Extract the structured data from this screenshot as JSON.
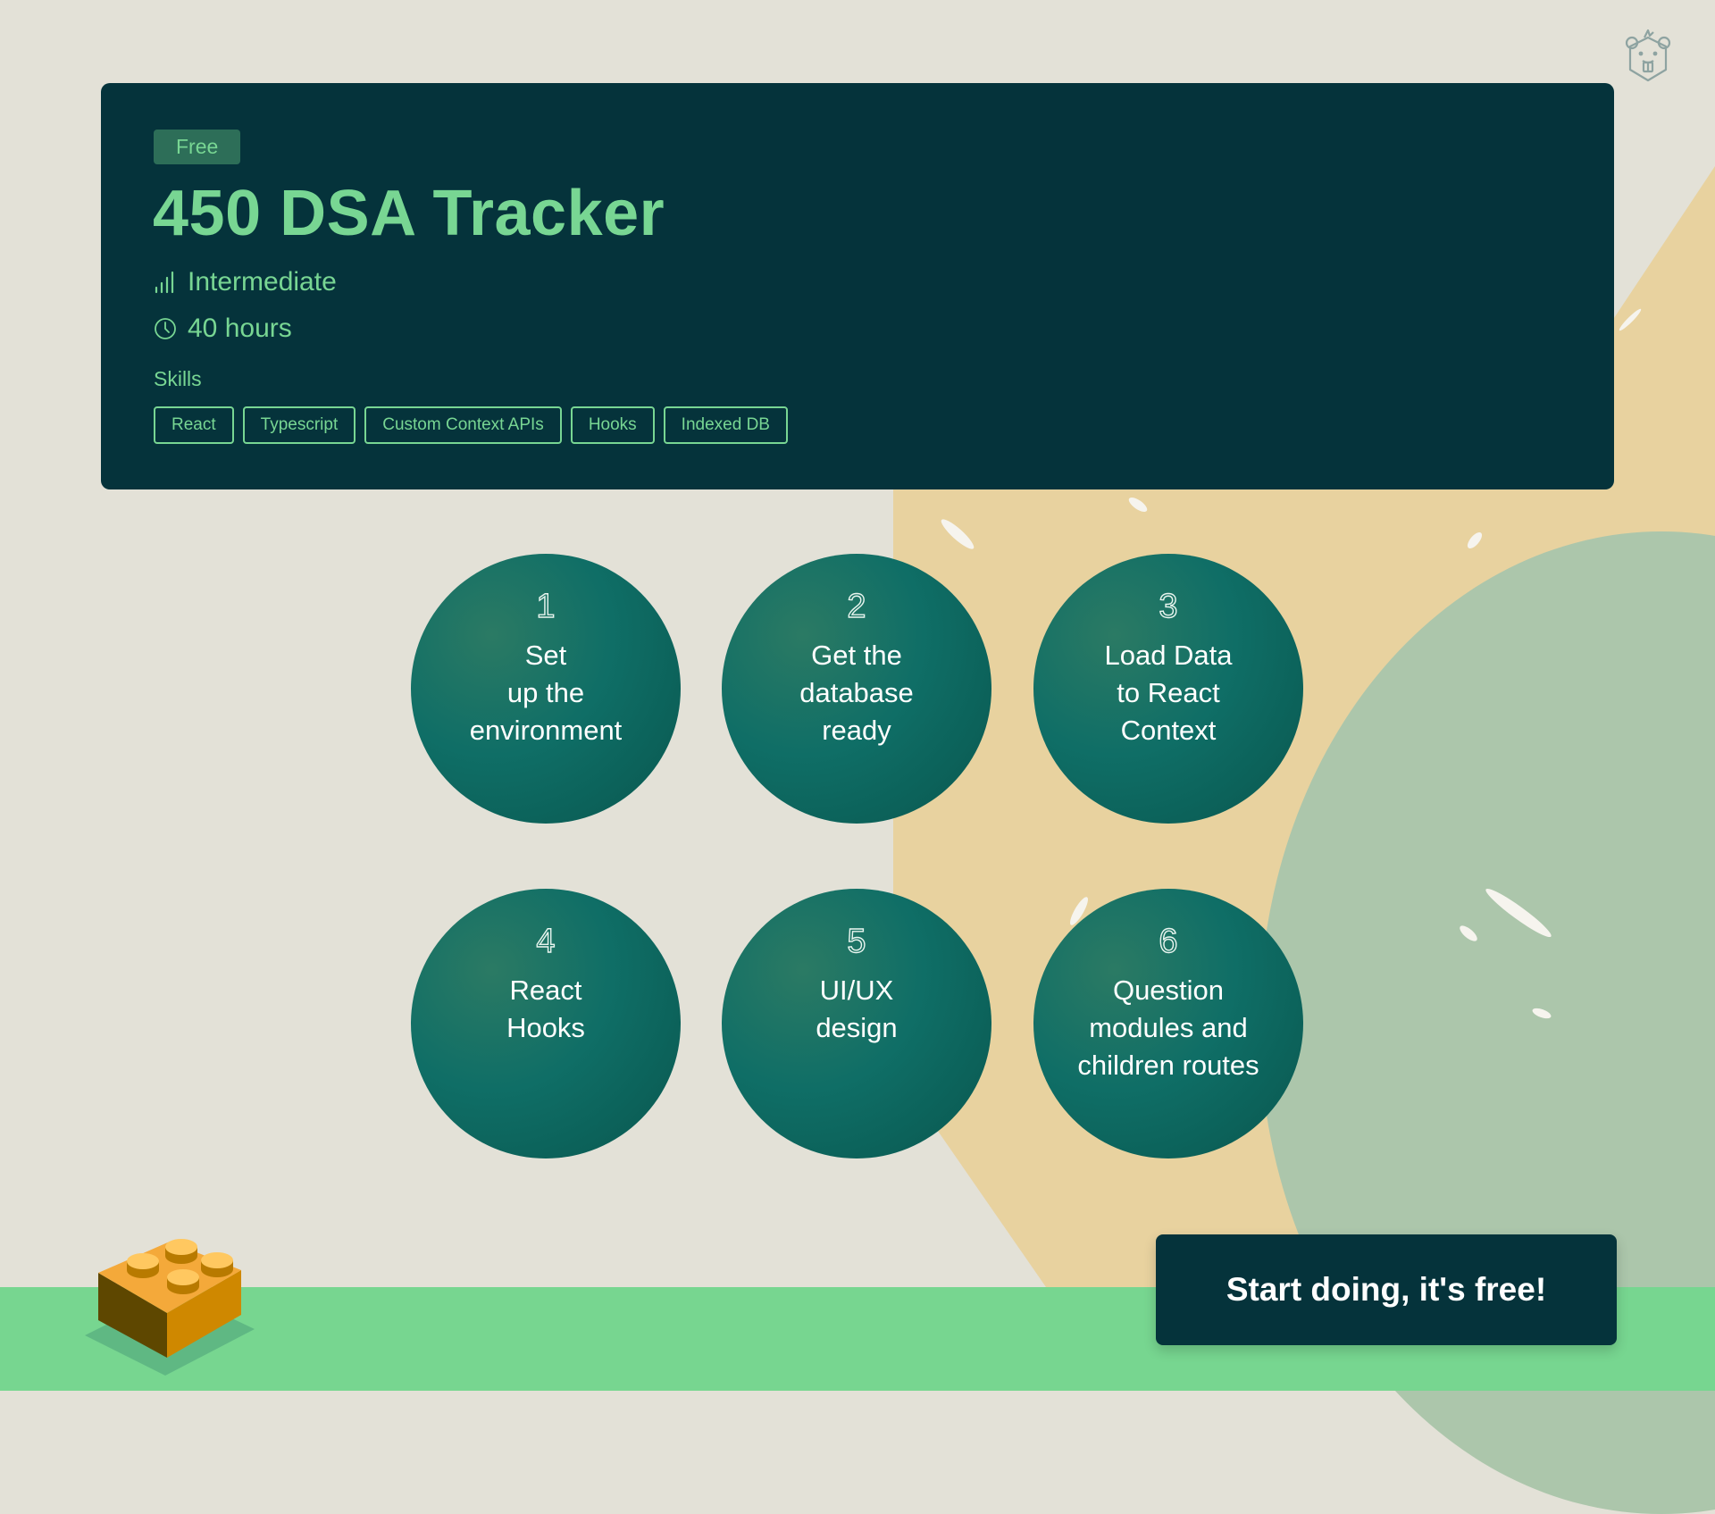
{
  "header": {
    "badge": "Free",
    "title": "450 DSA Tracker",
    "level": {
      "icon": "signal-bars-icon",
      "text": "Intermediate"
    },
    "duration": {
      "icon": "clock-icon",
      "text": "40 hours"
    },
    "skills_label": "Skills",
    "skills": [
      "React",
      "Typescript",
      "Custom Context APIs",
      "Hooks",
      "Indexed DB"
    ]
  },
  "mascot": {
    "icon": "beaver-logo-icon"
  },
  "steps": [
    {
      "number": "1",
      "label": "Set\nup the\nenvironment"
    },
    {
      "number": "2",
      "label": "Get the\ndatabase\nready"
    },
    {
      "number": "3",
      "label": "Load Data\nto React\nContext"
    },
    {
      "number": "4",
      "label": "React\nHooks"
    },
    {
      "number": "5",
      "label": "UI/UX\ndesign"
    },
    {
      "number": "6",
      "label": "Question\nmodules and\nchildren routes"
    }
  ],
  "cta": {
    "label": "Start doing, it's free!"
  },
  "decoration": {
    "icon": "lego-brick-icon"
  },
  "colors": {
    "card_bg": "#05333b",
    "accent_green": "#78d693",
    "badge_bg": "#2d6e58",
    "step_circle": "#0f6e66",
    "page_bg": "#e3e1d7",
    "sand": "#e8d19c",
    "sage": "#acc6ab",
    "ground": "#77d690"
  }
}
